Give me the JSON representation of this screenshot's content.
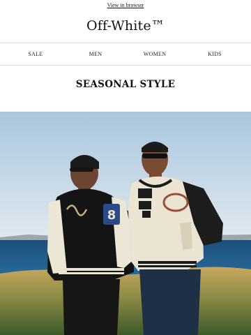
{
  "header": {
    "browser_link": "View in browser",
    "brand": "Off-White™"
  },
  "nav": {
    "items": [
      {
        "label": "SALE"
      },
      {
        "label": "MEN"
      },
      {
        "label": "WOMEN"
      },
      {
        "label": "KIDS"
      }
    ]
  },
  "section": {
    "title": "SEASONAL STYLE"
  },
  "hero": {
    "alt_icon": "hero-photo"
  }
}
